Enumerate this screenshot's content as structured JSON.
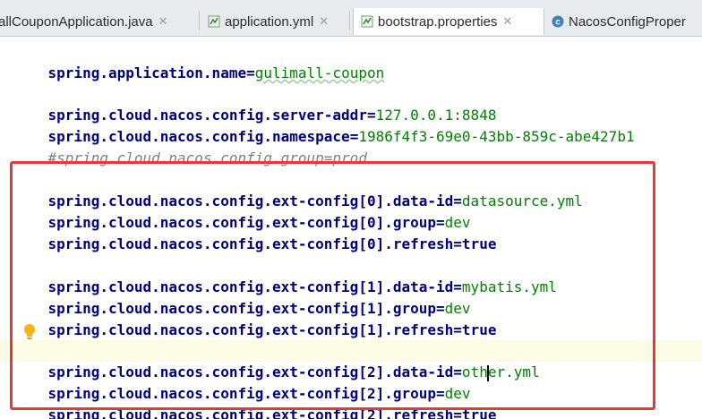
{
  "tabs": [
    {
      "label": "allCouponApplication.java",
      "icon": "java-class-icon",
      "active": false,
      "closable": true
    },
    {
      "label": "application.yml",
      "icon": "yaml-file-icon",
      "active": false,
      "closable": true
    },
    {
      "label": "bootstrap.properties",
      "icon": "properties-file-icon",
      "active": true,
      "closable": true
    },
    {
      "label": "NacosConfigProper",
      "icon": "class-c-icon",
      "active": false,
      "closable": false
    }
  ],
  "editor": {
    "lines": [
      {
        "key": "spring.application.name",
        "value": "gulimall-coupon"
      },
      {
        "key": "spring.cloud.nacos.config.server-addr",
        "value": "127.0.0.1:8848"
      },
      {
        "key": "spring.cloud.nacos.config.namespace",
        "value": "1986f4f3-69e0-43bb-859c-abe427b1"
      },
      {
        "comment": "#spring.cloud.nacos.config.group=prod"
      },
      {
        "key": "spring.cloud.nacos.config.ext-config[0].data-id",
        "value": "datasource.yml"
      },
      {
        "key": "spring.cloud.nacos.config.ext-config[0].group",
        "value": "dev"
      },
      {
        "key": "spring.cloud.nacos.config.ext-config[0].refresh",
        "value": "true"
      },
      {
        "key": "spring.cloud.nacos.config.ext-config[1].data-id",
        "value": "mybatis.yml"
      },
      {
        "key": "spring.cloud.nacos.config.ext-config[1].group",
        "value": "dev"
      },
      {
        "key": "spring.cloud.nacos.config.ext-config[1].refresh",
        "value": "true"
      },
      {
        "key": "spring.cloud.nacos.config.ext-config[2].data-id",
        "value_before_caret": "oth",
        "value_after_caret": "er.yml"
      },
      {
        "key": "spring.cloud.nacos.config.ext-config[2].group",
        "value": "dev"
      },
      {
        "key": "spring.cloud.nacos.config.ext-config[2].refresh",
        "value": "true"
      }
    ],
    "separator": "=",
    "highlight_color": "#e53935",
    "gutter_icon": "lightbulb-icon"
  },
  "colors": {
    "key": "#000080",
    "value": "#008000",
    "comment": "#808080",
    "cursor_line": "#fcfbe6"
  }
}
